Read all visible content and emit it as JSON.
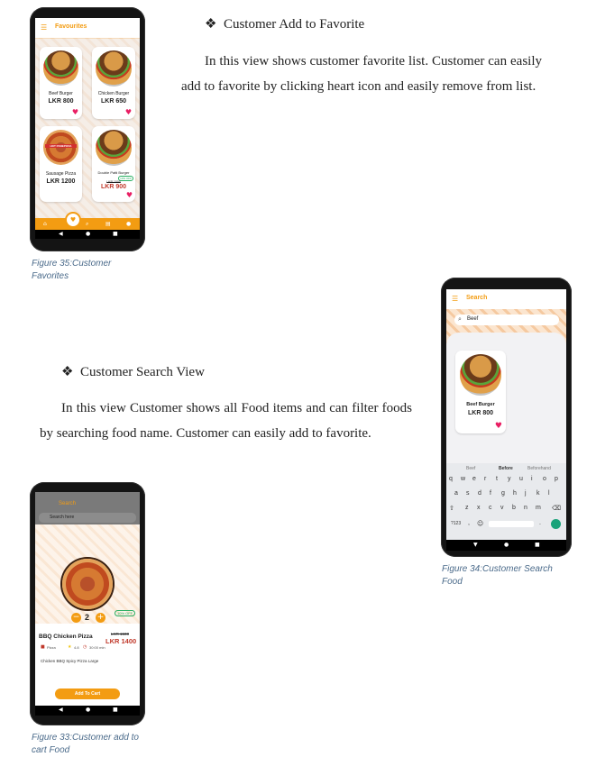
{
  "section_favorites": {
    "heading": "Customer Add to Favorite",
    "paragraph": "In this view shows customer favorite list. Customer can easily add to favorite by clicking heart icon and easily remove from list.",
    "caption": "Figure 35:Customer Favorites"
  },
  "section_search": {
    "heading": "Customer Search View",
    "paragraph": "In this view Customer shows all Food items and can filter foods by searching food name. Customer can easily add to favorite.",
    "caption": "Figure 34:Customer Search Food"
  },
  "section_cart": {
    "caption": "Figure 33:Customer add to cart Food"
  },
  "bullet_symbol": "❖",
  "favorites_screen": {
    "title": "Favourites",
    "items": [
      {
        "name": "Beef Burger",
        "price": "LKR 800"
      },
      {
        "name": "Chicken Burger",
        "price": "LKR 650"
      },
      {
        "name": "Sausage Pizza",
        "price": "LKR 1200"
      },
      {
        "name": "Double Patti Burger",
        "old_price": "LKR 1000",
        "price": "LKR 900",
        "badge": "10% OFF"
      }
    ],
    "pizza_banner": "HOT PANEPIZZA"
  },
  "search_screen": {
    "title": "Search",
    "query": "Beef",
    "result": {
      "name": "Beef Burger",
      "price": "LKR 800"
    },
    "suggestions": [
      "Beef",
      "Before",
      "Beforehand"
    ],
    "keyboard_rows": [
      [
        "q",
        "w",
        "e",
        "r",
        "t",
        "y",
        "u",
        "i",
        "o",
        "p"
      ],
      [
        "a",
        "s",
        "d",
        "f",
        "g",
        "h",
        "j",
        "k",
        "l"
      ],
      [
        "z",
        "x",
        "c",
        "v",
        "b",
        "n",
        "m"
      ]
    ],
    "numeric_key": "?123"
  },
  "cart_screen": {
    "title": "Search",
    "search_placeholder": "Search here",
    "quantity": "2",
    "discount": "10% OFF",
    "item_name": "BBQ Chicken Pizza",
    "old_price": "LKR 1500",
    "price": "LKR 1400",
    "category": "Pizza",
    "rating": "4.8",
    "time": "30:00 min",
    "description": "Chicken BBQ Spicy Pizza Large",
    "add_to_cart_label": "Add To Cart"
  },
  "colors": {
    "accent": "#f39c12",
    "heart": "#e91e63",
    "price_red": "#c0392b",
    "caption": "#4a6a8a"
  }
}
